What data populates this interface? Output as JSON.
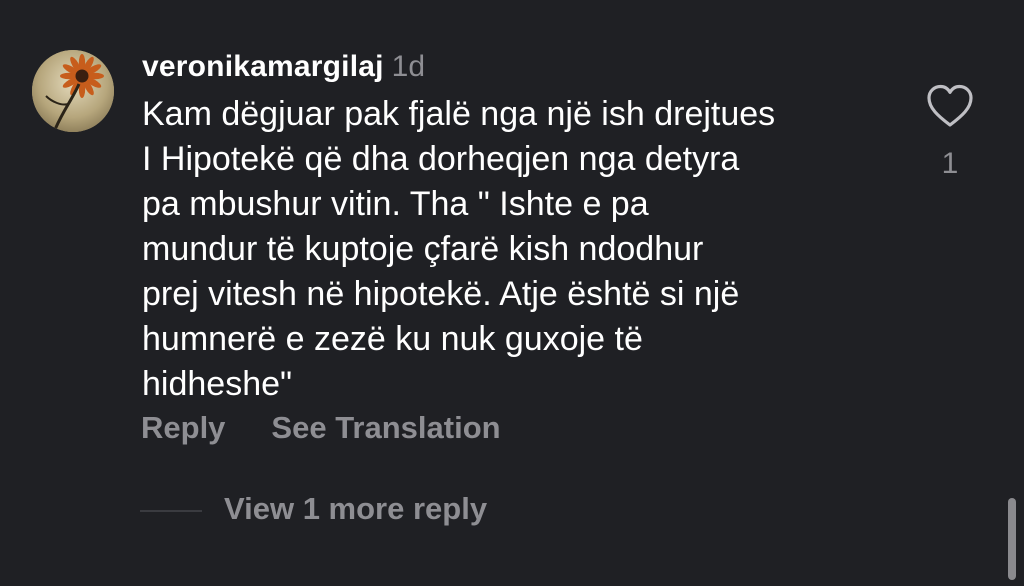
{
  "comment": {
    "username": "veronikamargilaj",
    "timestamp": "1d",
    "text": "Kam dëgjuar pak fjalë nga një ish drejtues\nI Hipotekë që dha dorheqjen nga detyra\npa mbushur vitin. Tha \" Ishte e pa\nmundur të kuptoje çfarë kish ndodhur\nprej vitesh në hipotekë. Atje është si një\nhumnerë e zezë ku nuk guxoje të\nhidheshe\"",
    "like_count": "1",
    "avatar_icon": "sunflower-avatar",
    "like_icon": "heart-outline-icon"
  },
  "actions": {
    "reply_label": "Reply",
    "translate_label": "See Translation"
  },
  "replies": {
    "view_more_label": "View 1 more reply"
  }
}
